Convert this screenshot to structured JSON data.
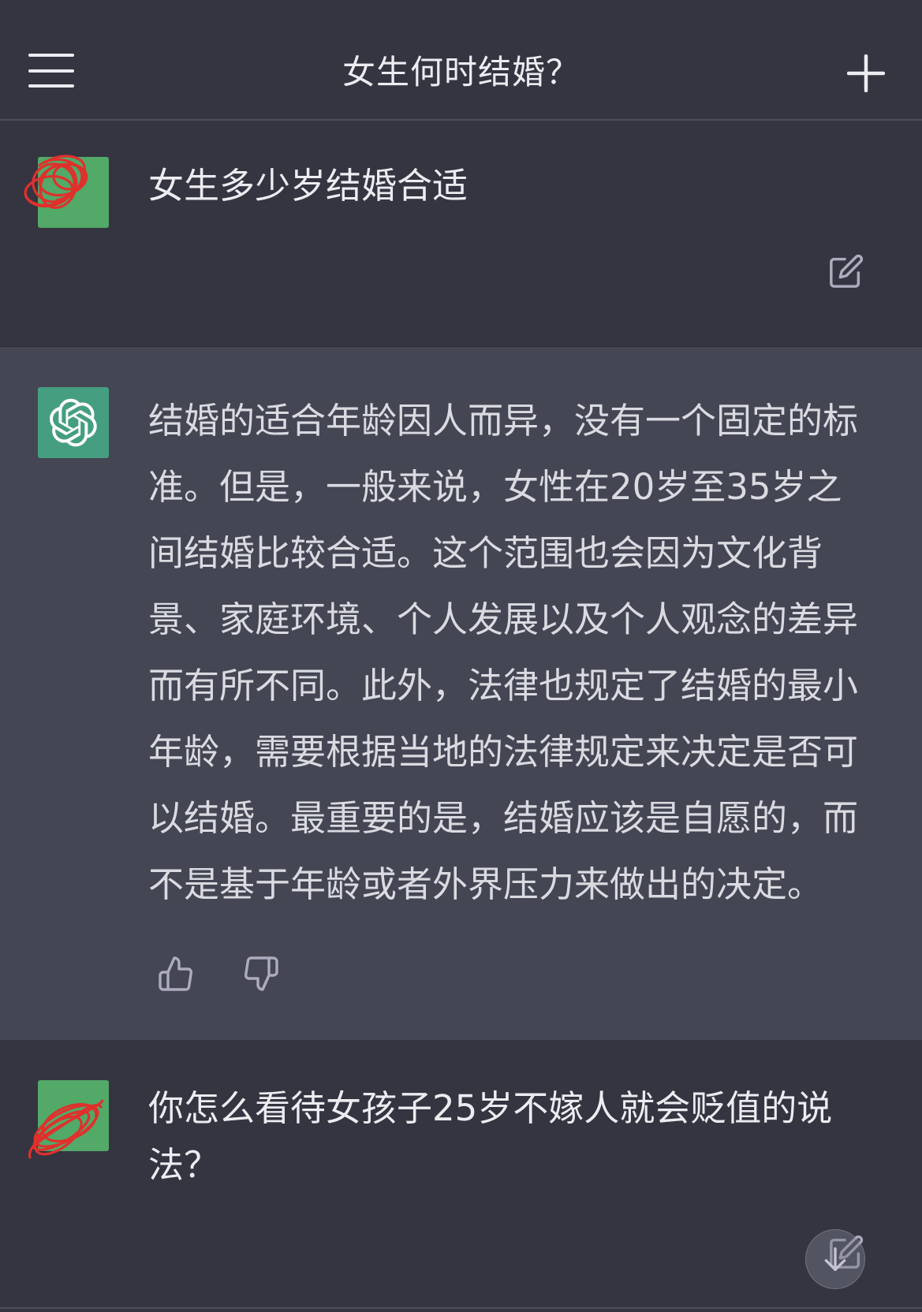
{
  "header": {
    "title": "女生何时结婚？",
    "menu_icon": "hamburger-menu-icon",
    "new_chat_icon": "plus-icon"
  },
  "theme": {
    "background": "#343541",
    "assistant_background": "#444654",
    "user_avatar_color": "#52a968",
    "assistant_avatar_color": "#459e80",
    "redaction_color": "#e0302c",
    "text_color": "#ececf1",
    "icon_color": "#acacbe"
  },
  "conversation": {
    "user_message_1": {
      "avatar_icon": "user-avatar-icon",
      "lines": [
        "女生多少岁结婚合适"
      ],
      "action_icon": "edit-icon"
    },
    "assistant_message": {
      "avatar_icon": "openai-logo-icon",
      "lines": [
        "结婚的适合年龄因人而异，没有一个固定的标",
        "准。但是，一般来说，女性在20岁至35岁之",
        "间结婚比较合适。这个范围也会因为文化背",
        "景、家庭环境、个人发展以及个人观念的差异",
        "而有所不同。此外，法律也规定了结婚的最小",
        "年龄，需要根据当地的法律规定来决定是否可",
        "以结婚。最重要的是，结婚应该是自愿的，而",
        "不是基于年龄或者外界压力来做出的决定。"
      ],
      "feedback_icons": [
        "thumbs-up-icon",
        "thumbs-down-icon"
      ]
    },
    "user_message_2": {
      "avatar_icon": "user-avatar-icon",
      "lines": [
        "你怎么看待女孩子25岁不嫁人就会贬值的说",
        "法？"
      ],
      "action_icon": "edit-icon"
    }
  },
  "scroll_to_bottom_icon": "arrow-down-icon"
}
